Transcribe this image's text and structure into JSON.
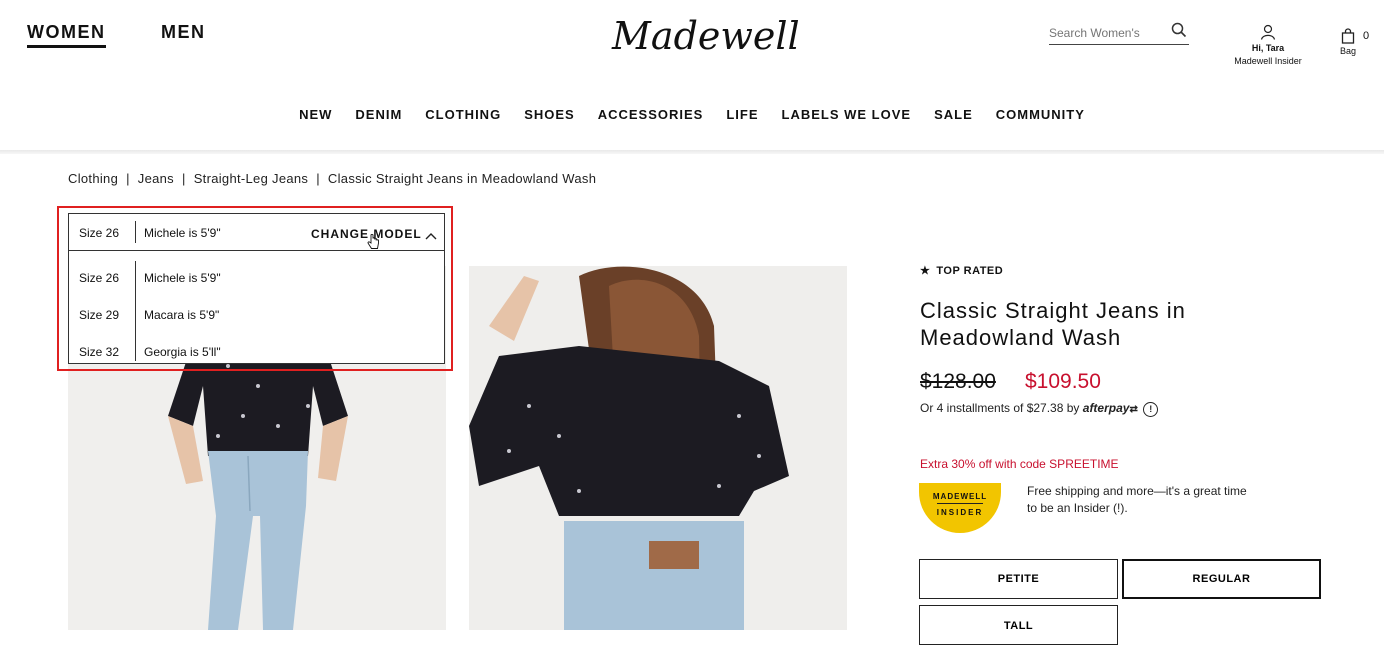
{
  "header": {
    "gender_tabs": [
      "WOMEN",
      "MEN"
    ],
    "logo": "Madewell",
    "search_placeholder": "Search Women's",
    "account": {
      "greeting": "Hi, Tara",
      "status": "Madewell Insider"
    },
    "bag": {
      "label": "Bag",
      "count": "0"
    }
  },
  "nav": [
    "NEW",
    "DENIM",
    "CLOTHING",
    "SHOES",
    "ACCESSORIES",
    "LIFE",
    "LABELS WE LOVE",
    "SALE",
    "COMMUNITY"
  ],
  "breadcrumb": [
    "Clothing",
    "Jeans",
    "Straight-Leg Jeans",
    "Classic Straight Jeans in Meadowland Wash"
  ],
  "breadcrumb_sep": "|",
  "model_selector": {
    "selected": {
      "size": "Size 26",
      "model": "Michele is 5'9\""
    },
    "change_label": "CHANGE MODEL",
    "options": [
      {
        "size": "Size 26",
        "model": "Michele is 5'9\""
      },
      {
        "size": "Size 29",
        "model": "Macara is 5'9\""
      },
      {
        "size": "Size 32",
        "model": "Georgia is 5'll\""
      }
    ]
  },
  "product": {
    "badge": "TOP RATED",
    "title": "Classic Straight Jeans in Meadowland Wash",
    "price_original": "$128.00",
    "price_sale": "$109.50",
    "installments_text": "Or 4 installments of $27.38 by",
    "installments_brand": "afterpay",
    "promo": "Extra 30% off with code SPREETIME",
    "insider_badge_top": "MADEWELL",
    "insider_badge_bottom": "INSIDER",
    "insider_text": "Free shipping and more—it's a great time to be an Insider (!).",
    "fits": [
      "PETITE",
      "REGULAR",
      "TALL"
    ],
    "selected_fit": "REGULAR"
  },
  "colors": {
    "sale_red": "#c8102e",
    "highlight_red": "#e02020",
    "insider_yellow": "#f2c500"
  }
}
